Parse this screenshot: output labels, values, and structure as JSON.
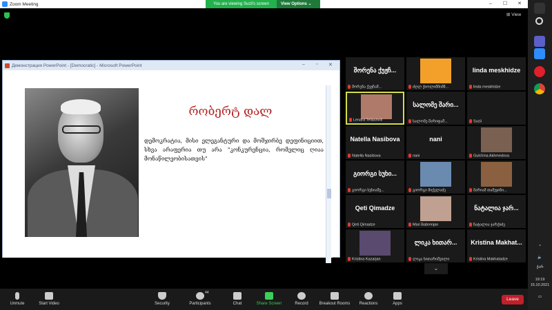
{
  "window": {
    "title": "Zoom Meeting",
    "min": "–",
    "max": "☐",
    "close": "✕"
  },
  "banner": {
    "viewing": "You are viewing Suzii's screen",
    "options": "View Options ⌄"
  },
  "view_btn": "⊞ View",
  "ppt": {
    "title": "Демонстрация PowerPoint - [Democratic] - Microsoft PowerPoint",
    "slide_title": "რობერტ დალ",
    "slide_body": "დემოკრატია, მისი ელეგანტური და მოშჯირბე დეფინიციით, სხვა არაფერია თუ არა \"კონკურენცია, რომელიც ღიაა მონაწილეობისათვის\""
  },
  "tiles": [
    {
      "big": "შორენა ქუჟჩ...",
      "name": "შორენა ქუჟჩაშ...",
      "pic": false
    },
    {
      "big": "",
      "name": "ძღლ ქიოლიშმიშმ...",
      "pic": true,
      "pic_color": "#f2a02a"
    },
    {
      "big": "linda meskhidze",
      "name": "linda meskhidze",
      "pic": false
    },
    {
      "big": "",
      "name": "Lenara Tellashvili",
      "pic": true,
      "pic_color": "#b07a6a",
      "active": true
    },
    {
      "big": "სალომე შარი...",
      "name": "სალომე შარიფაშ...",
      "pic": false
    },
    {
      "big": "",
      "name": "Suzii",
      "pic": false
    },
    {
      "big": "Natella Nasibova",
      "name": "Natella Nasibova",
      "pic": false
    },
    {
      "big": "nani",
      "name": "nani",
      "pic": false
    },
    {
      "big": "",
      "name": "Gulchina Akhmedova",
      "pic": true,
      "pic_color": "#7a6050"
    },
    {
      "big": "გიორგი სუხი...",
      "name": "გიორგი სუხიაშვ...",
      "pic": false
    },
    {
      "big": "",
      "name": "გიორგი მიქელაძე",
      "pic": true,
      "pic_color": "#6a8ab0"
    },
    {
      "big": "",
      "name": "მარიამ თამუჯინი...",
      "pic": true,
      "pic_color": "#8a6040"
    },
    {
      "big": "Qeti Qimadze",
      "name": "Qeti Qimadze",
      "pic": false
    },
    {
      "big": "",
      "name": "Mari Babrenjan",
      "pic": true,
      "pic_color": "#c0a090"
    },
    {
      "big": "ნატალია ჯარ...",
      "name": "ნატალია ჯარქიძე",
      "pic": false
    },
    {
      "big": "",
      "name": "Kristina Kazarjan",
      "pic": true,
      "pic_color": "#5a4a70"
    },
    {
      "big": "ლიკა ხითარ...",
      "name": "ლიკა ხითარიშვილი",
      "pic": false
    },
    {
      "big": "Kristina Makhat...",
      "name": "Kristina Makhatadze",
      "pic": false
    }
  ],
  "toolbar": {
    "unmute": "Unmute",
    "start_video": "Start Video",
    "security": "Security",
    "participants": "Participants",
    "participants_count": "44",
    "chat": "Chat",
    "share": "Share Screen",
    "record": "Record",
    "breakout": "Breakout Rooms",
    "reactions": "Reactions",
    "apps": "Apps",
    "leave": "Leave"
  },
  "system": {
    "lang": "ქარ",
    "time": "19:19",
    "date": "15.10.2021"
  }
}
